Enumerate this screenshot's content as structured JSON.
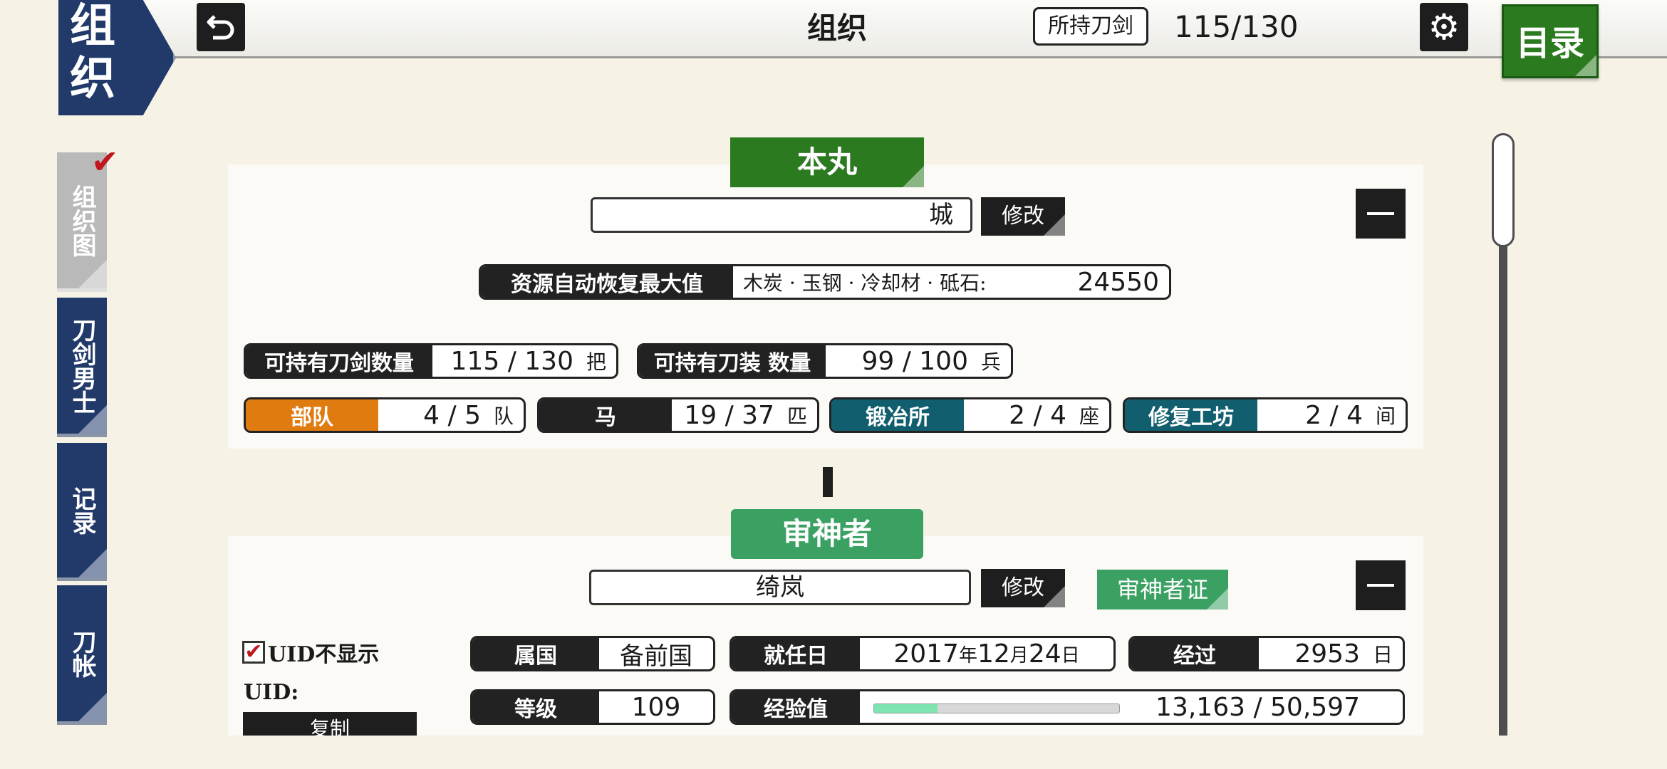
{
  "header": {
    "corner_title_line1": "组",
    "corner_title_line2": "织",
    "title": "组织",
    "held_label": "所持刀剑",
    "held_count": "115/130",
    "menu_label": "目录"
  },
  "sidebar": {
    "tabs": [
      {
        "label": "组织图",
        "active": true
      },
      {
        "label": "刀剑男士",
        "active": false
      },
      {
        "label": "记录",
        "active": false
      },
      {
        "label": "刀帐",
        "active": false
      }
    ]
  },
  "honmaru": {
    "heading": "本丸",
    "name_value": "城",
    "edit_label": "修改",
    "resource_label": "资源自动恢复最大值",
    "resource_items": "木炭 · 玉钢 · 冷却材 · 砥石:",
    "resource_value": "24550",
    "swords_label": "可持有刀剑数量",
    "swords_value": "115 / 130",
    "swords_unit": "把",
    "equip_label": "可持有刀装 数量",
    "equip_value": "99 / 100",
    "equip_unit": "兵",
    "units_label": "部队",
    "units_value": "4 / 5",
    "units_unit": "队",
    "horse_label": "马",
    "horse_value": "19 / 37",
    "horse_unit": "匹",
    "forge_label": "锻冶所",
    "forge_value": "2 / 4",
    "forge_unit": "座",
    "repair_label": "修复工坊",
    "repair_value": "2 / 4",
    "repair_unit": "间"
  },
  "saniwa": {
    "heading": "审神者",
    "name_value": "绮岚",
    "edit_label": "修改",
    "cert_label": "审神者证",
    "uid_hide_label": "UID不显示",
    "uid_label": "UID:",
    "copy_label": "复制",
    "province_label": "属国",
    "province_value": "备前国",
    "start_label": "就任日",
    "start_year": "2017",
    "start_year_unit": "年",
    "start_month": "12",
    "start_month_unit": "月",
    "start_day": "24",
    "start_day_unit": "日",
    "elapsed_label": "经过",
    "elapsed_value": "2953",
    "elapsed_unit": "日",
    "level_label": "等级",
    "level_value": "109",
    "exp_label": "经验值",
    "exp_value": "13,163 / 50,597",
    "exp_progress": 0.26
  },
  "colors": {
    "navy": "#223a6a",
    "green": "#2b7a1f",
    "saniwa_green": "#3aa162",
    "orange": "#e07b10",
    "teal": "#115f6e"
  }
}
